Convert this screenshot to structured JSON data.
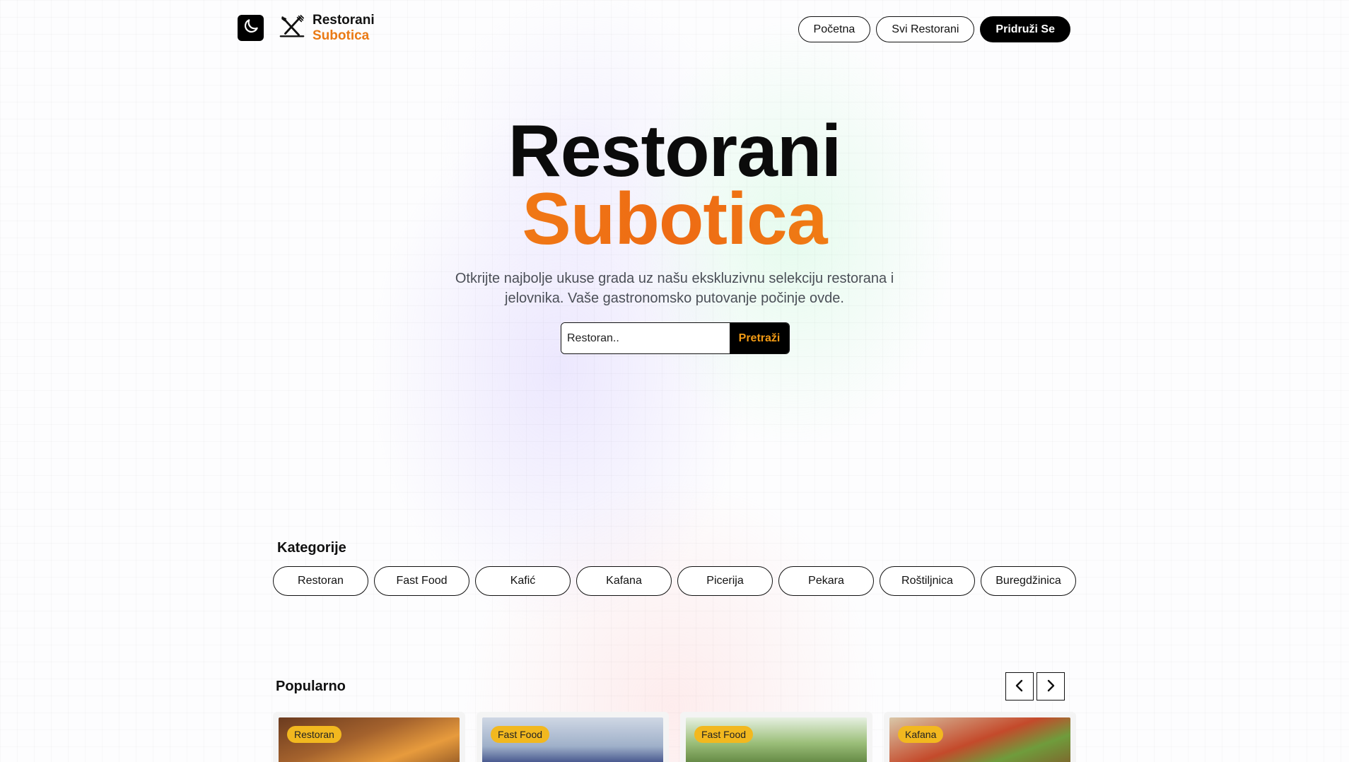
{
  "header": {
    "theme_toggle_icon": "moon-icon",
    "logo_icon": "fork-knife-icon",
    "brand_line1": "Restorani",
    "brand_line2": "Subotica",
    "nav": {
      "home": "Početna",
      "all_restaurants": "Svi Restorani",
      "join": "Pridruži Se"
    }
  },
  "hero": {
    "title_line1": "Restorani",
    "title_line2": "Subotica",
    "subtitle": "Otkrijte najbolje ukuse grada uz našu ekskluzivnu selekciju restorana i jelovnika. Vaše gastronomsko putovanje počinje ovde.",
    "search": {
      "placeholder": "Restoran..",
      "button": "Pretraži"
    }
  },
  "categories": {
    "title": "Kategorije",
    "items": [
      "Restoran",
      "Fast Food",
      "Kafić",
      "Kafana",
      "Picerija",
      "Pekara",
      "Roštiljnica",
      "Buregdžinica"
    ]
  },
  "popular": {
    "title": "Popularno",
    "prev_icon": "chevron-left-icon",
    "next_icon": "chevron-right-icon",
    "cards": [
      {
        "badge": "Restoran"
      },
      {
        "badge": "Fast Food"
      },
      {
        "badge": "Fast Food"
      },
      {
        "badge": "Kafana"
      }
    ]
  },
  "colors": {
    "accent": "#ea7a14",
    "badge": "#f2b81f",
    "dark": "#000000"
  }
}
